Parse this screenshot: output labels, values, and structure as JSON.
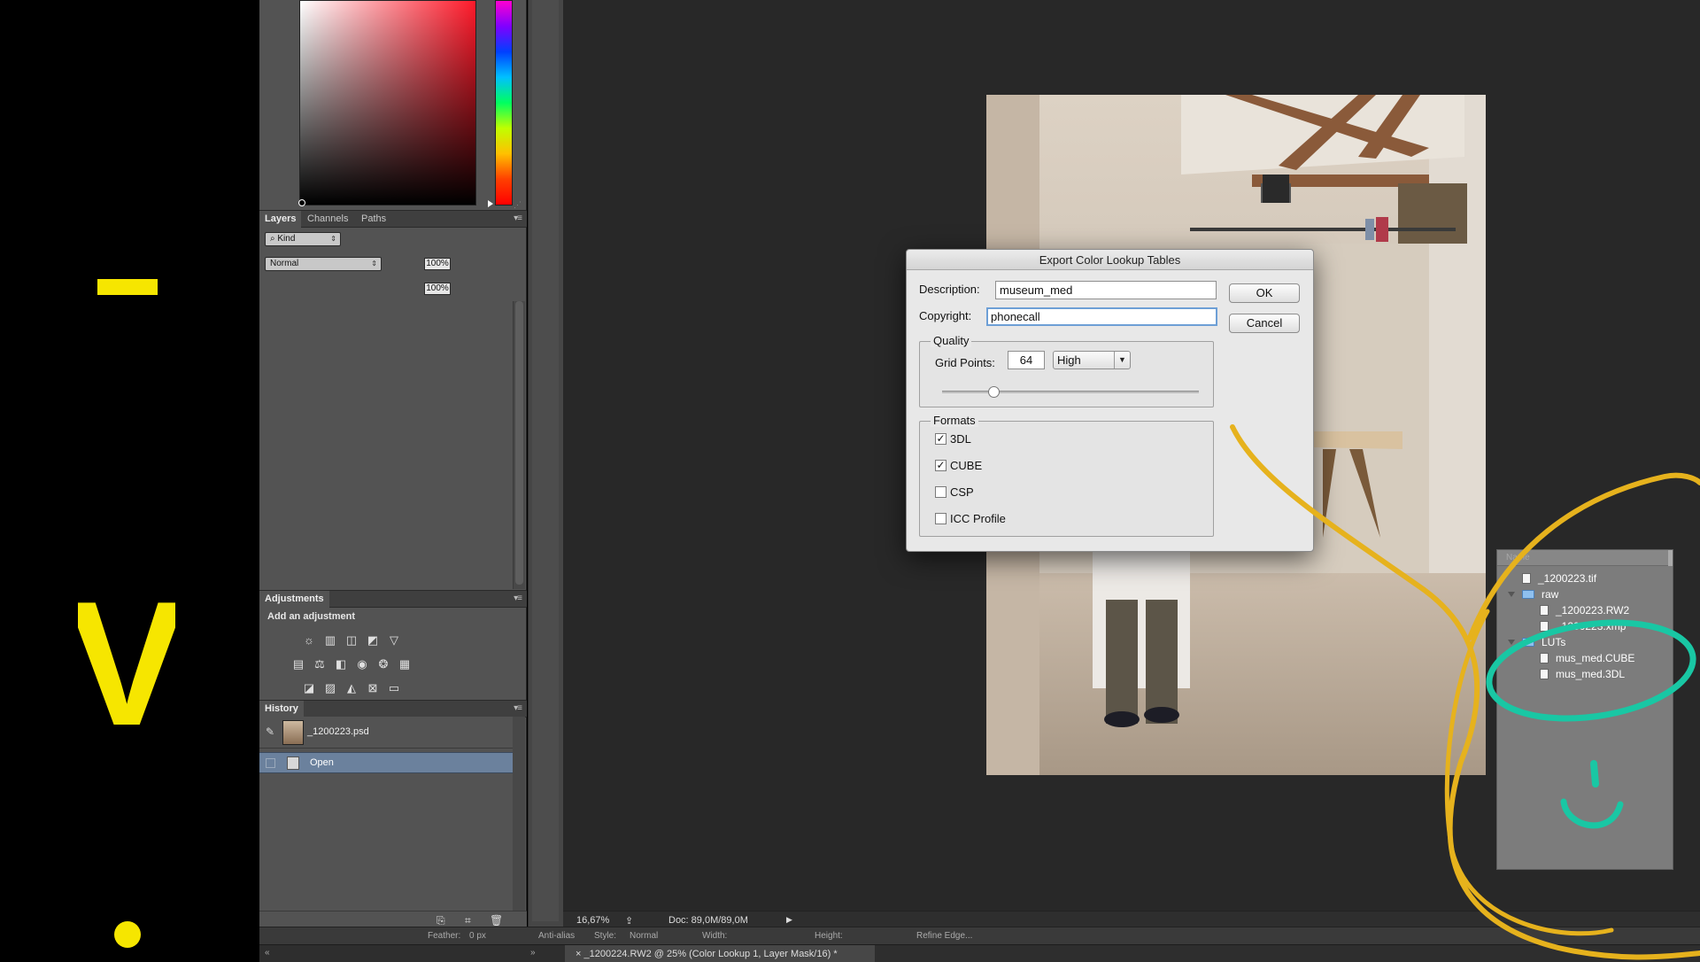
{
  "colors": {
    "annotation_yellow": "#f6e600",
    "annotation_orange": "#e6b21d",
    "annotation_teal": "#19c7a4",
    "panel_bg": "#535353",
    "workspace_bg": "#282828",
    "history_selected": "#6b819d"
  },
  "annotations": {
    "letter_v": "V"
  },
  "layers_panel": {
    "tabs": [
      "Layers",
      "Channels",
      "Paths"
    ],
    "filter_kind": "Kind",
    "blend_mode": "Normal",
    "opacity": "100%",
    "fill": "100%",
    "menu_icon": "panel-menu-icon"
  },
  "adjustments_panel": {
    "tab": "Adjustments",
    "title": "Add an adjustment",
    "icons_row1": [
      "brightness-icon",
      "levels-icon",
      "curves-icon",
      "exposure-icon",
      "vibrance-icon"
    ],
    "icons_row2": [
      "hue-saturation-icon",
      "color-balance-icon",
      "black-white-icon",
      "photo-filter-icon",
      "channel-mixer-icon",
      "color-lookup-icon"
    ],
    "icons_row3": [
      "invert-icon",
      "posterize-icon",
      "threshold-icon",
      "selective-color-icon",
      "gradient-map-icon"
    ]
  },
  "history_panel": {
    "tab": "History",
    "snapshot": "_1200223.psd",
    "state": "Open"
  },
  "status_bar": {
    "zoom": "16,67%",
    "doc": "Doc: 89,0M/89,0M"
  },
  "options_bar": {
    "feather_label": "Feather:",
    "feather_value": "0 px",
    "anti_alias": "Anti-alias",
    "style_label": "Style:",
    "style_value": "Normal",
    "width_label": "Width:",
    "height_label": "Height:",
    "refine": "Refine Edge..."
  },
  "doc_tab": {
    "title": "_1200224.RW2 @ 25% (Color Lookup 1, Layer Mask/16) *"
  },
  "dialog": {
    "title": "Export Color Lookup Tables",
    "description_label": "Description:",
    "description_value": "museum_med",
    "copyright_label": "Copyright:",
    "copyright_value": "phonecall",
    "ok": "OK",
    "cancel": "Cancel",
    "quality_group": "Quality",
    "grid_points_label": "Grid Points:",
    "grid_points_value": "64",
    "quality_value": "High",
    "quality_slider_fraction": 0.2,
    "formats_group": "Formats",
    "formats": [
      {
        "label": "3DL",
        "checked": true
      },
      {
        "label": "CUBE",
        "checked": true
      },
      {
        "label": "CSP",
        "checked": false
      },
      {
        "label": "ICC Profile",
        "checked": false
      }
    ]
  },
  "file_browser": {
    "header": "Name",
    "items": [
      {
        "name": "_1200223.tif",
        "kind": "file",
        "depth": 0
      },
      {
        "name": "raw",
        "kind": "folder",
        "depth": 0
      },
      {
        "name": "_1200223.RW2",
        "kind": "file",
        "depth": 1
      },
      {
        "name": "_1200223.xmp",
        "kind": "file",
        "depth": 1
      },
      {
        "name": "LUTs",
        "kind": "folder",
        "depth": 0
      },
      {
        "name": "mus_med.CUBE",
        "kind": "file",
        "depth": 1
      },
      {
        "name": "mus_med.3DL",
        "kind": "file",
        "depth": 1
      }
    ]
  }
}
